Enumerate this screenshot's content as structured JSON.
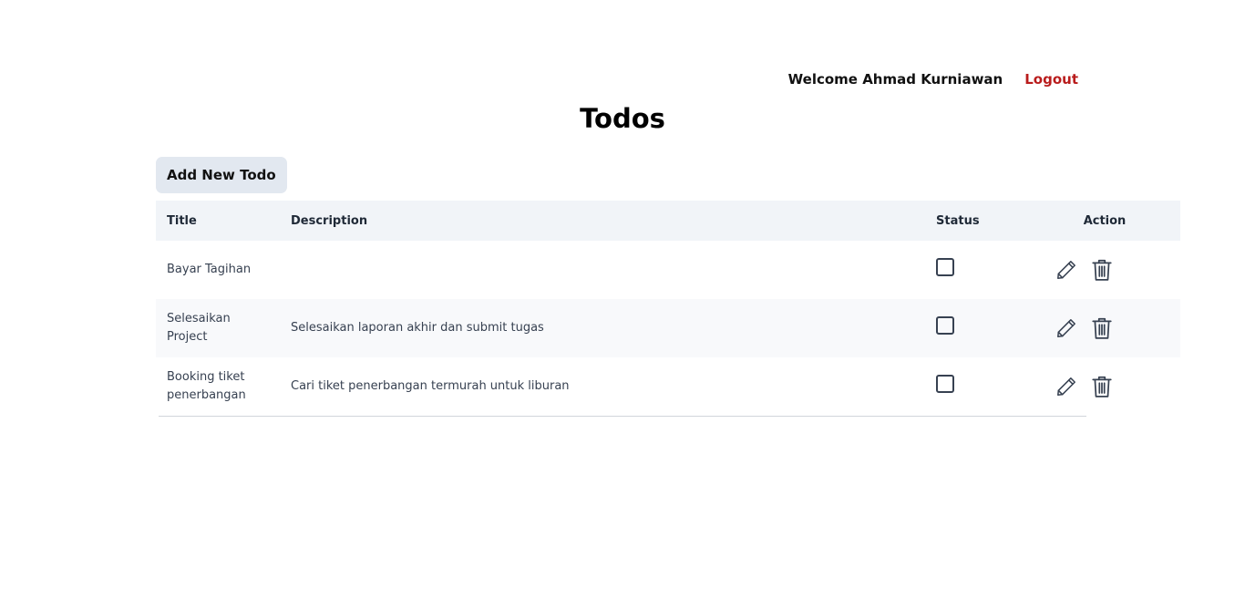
{
  "header": {
    "welcome_text": "Welcome Ahmad Kurniawan",
    "logout_label": "Logout"
  },
  "page": {
    "title": "Todos"
  },
  "toolbar": {
    "add_label": "Add New Todo"
  },
  "table": {
    "columns": [
      "Title",
      "Description",
      "Status",
      "Action"
    ],
    "rows": [
      {
        "title": "Bayar Tagihan",
        "description": "",
        "status_checked": false
      },
      {
        "title": "Selesaikan Project",
        "description": "Selesaikan laporan akhir dan submit tugas",
        "status_checked": false
      },
      {
        "title": "Booking tiket penerbangan",
        "description": "Cari tiket penerbangan termurah untuk liburan",
        "status_checked": false
      }
    ]
  },
  "icons": {
    "edit": "pencil-icon",
    "delete": "trash-icon"
  },
  "colors": {
    "logout": "#b91c1c",
    "button_bg": "#e2e8f0",
    "header_bg": "#f1f4f8",
    "icon": "#374151"
  }
}
